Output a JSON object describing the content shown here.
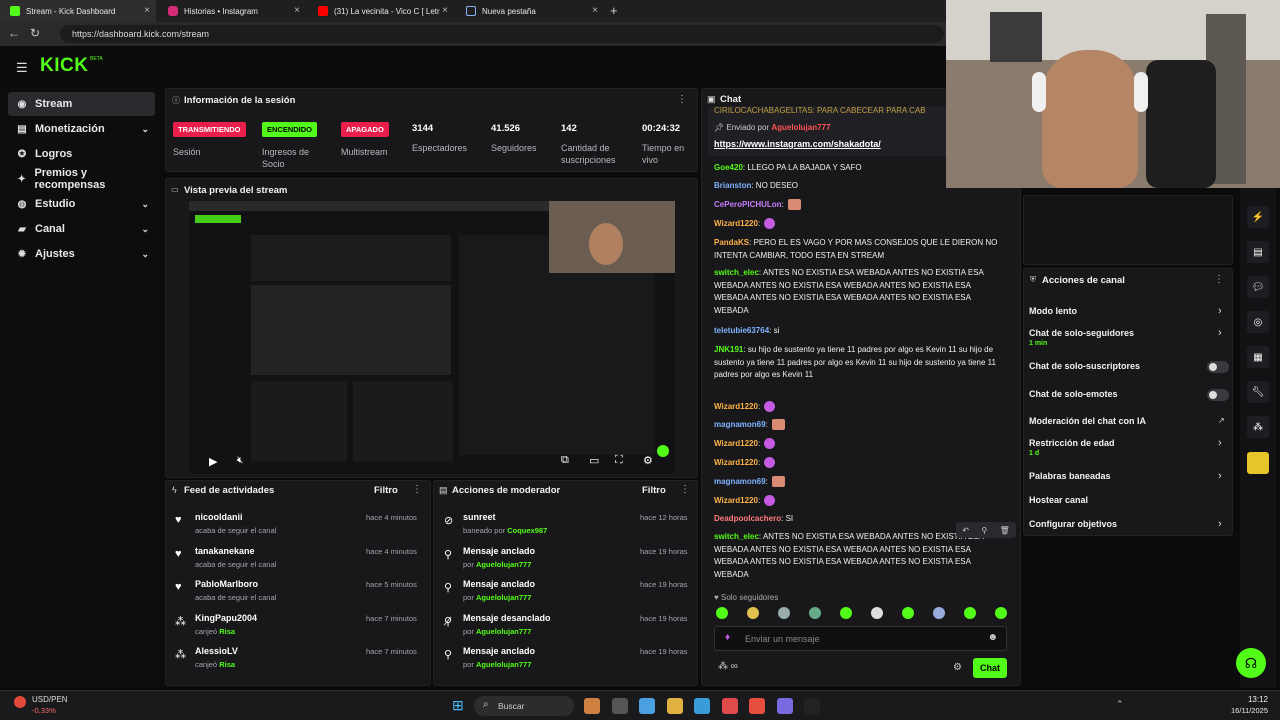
{
  "browser": {
    "tabs": [
      {
        "label": "Stream - Kick Dashboard",
        "color": "#53fc18"
      },
      {
        "label": "Historias • Instagram",
        "color": "#d62976"
      },
      {
        "label": "(31) La vecinita - Vico C [ Letra ] -",
        "color": "#ff0000"
      },
      {
        "label": "Nueva pestaña",
        "color": "#8ab4f8"
      }
    ],
    "new_tab": "+",
    "url": "https://dashboard.kick.com/stream"
  },
  "brand": {
    "logo": "KICK",
    "tag": "BETA"
  },
  "sidebar": {
    "items": [
      {
        "label": "Stream",
        "icon": "stream-icon",
        "glyph": "◉"
      },
      {
        "label": "Monetización",
        "icon": "money-icon",
        "glyph": "▤",
        "chev": "⌄"
      },
      {
        "label": "Logros",
        "icon": "trophy-icon",
        "glyph": "✪"
      },
      {
        "label": "Premios y recompensas",
        "icon": "gift-icon",
        "glyph": "✦"
      },
      {
        "label": "Estudio",
        "icon": "studio-icon",
        "glyph": "◍",
        "chev": "⌄"
      },
      {
        "label": "Canal",
        "icon": "channel-icon",
        "glyph": "▰",
        "chev": "⌄"
      },
      {
        "label": "Ajustes",
        "icon": "settings-icon",
        "glyph": "✹",
        "chev": "⌄"
      }
    ]
  },
  "session": {
    "title": "Información de la sesión",
    "stats": [
      {
        "badge": "TRANSMITIENDO",
        "badge_color": "#e91e4b",
        "label": "Sesión"
      },
      {
        "badge": "ENCENDIDO",
        "badge_color": "#53fc18",
        "label": "Ingresos de Socio"
      },
      {
        "badge": "APAGADO",
        "badge_color": "#e91e4b",
        "label": "Multistream"
      },
      {
        "value": "3144",
        "label": "Espectadores"
      },
      {
        "value": "41.526",
        "label": "Seguidores"
      },
      {
        "value": "142",
        "label": "Cantidad de suscripciones"
      },
      {
        "value": "00:24:32",
        "label": "Tiempo en vivo"
      }
    ]
  },
  "preview": {
    "title": "Vista previa del stream"
  },
  "activity": {
    "title": "Feed de actividades",
    "filter": "Filtro",
    "items": [
      {
        "name": "nicooldanii",
        "sub": "acaba de seguir el canal",
        "time": "hace 4 minutos",
        "icon": "heart-icon"
      },
      {
        "name": "tanakanekane",
        "sub": "acaba de seguir el canal",
        "time": "hace 4 minutos",
        "icon": "heart-icon"
      },
      {
        "name": "PabloMarlboro",
        "sub": "acaba de seguir el canal",
        "time": "hace 5 minutos",
        "icon": "heart-icon"
      },
      {
        "name": "KingPapu2004",
        "sub": "canjeó",
        "extra": "Risa",
        "time": "hace 7 minutos",
        "icon": "redeem-icon"
      },
      {
        "name": "AlessioLV",
        "sub": "canjeó",
        "extra": "Risa",
        "time": "hace 7 minutos",
        "icon": "redeem-icon"
      }
    ]
  },
  "moderation": {
    "title": "Acciones de moderador",
    "filter": "Filtro",
    "items": [
      {
        "name": "sunreet",
        "sub": "baneado por",
        "by": "Coquex987",
        "time": "hace 12 horas",
        "icon": "ban-icon"
      },
      {
        "name": "Mensaje anclado",
        "sub": "por",
        "by": "Aguelolujan777",
        "time": "hace 19 horas",
        "icon": "pin-icon"
      },
      {
        "name": "Mensaje anclado",
        "sub": "por",
        "by": "Aguelolujan777",
        "time": "hace 19 horas",
        "icon": "pin-icon"
      },
      {
        "name": "Mensaje desanclado",
        "sub": "por",
        "by": "Aguelolujan777",
        "time": "hace 19 horas",
        "icon": "unpin-icon"
      },
      {
        "name": "Mensaje anclado",
        "sub": "por",
        "by": "Aguelolujan777",
        "time": "hace 19 horas",
        "icon": "pin-icon"
      }
    ]
  },
  "chat": {
    "title": "Chat",
    "pinned": {
      "label": "Enviado por",
      "user": "Aguelolujan777",
      "link": "https://www.instagram.com/shakadota/",
      "top": "CIRILOCACHABAGELITAS: PARA CABECEAR  PARA CAB"
    },
    "messages": [
      {
        "user": "Goe420",
        "color": "#53fc18",
        "text": "LLEGO PA LA BAJADA Y SAFO"
      },
      {
        "user": "Brianston",
        "color": "#7fb3ff",
        "text": "NO DESEO"
      },
      {
        "user": "CePeroPICHULon",
        "color": "#c77dff",
        "text": ""
      },
      {
        "user": "Wizard1220",
        "color": "#ffb347",
        "text": ""
      },
      {
        "user": "PandaKS",
        "color": "#ffb347",
        "text": "PERO EL ES VAGO Y POR MAS CONSEJOS QUE LE DIERON NO INTENTA CAMBIAR, TODO ESTA EN STREAM"
      },
      {
        "user": "switch_elec",
        "color": "#53fc18",
        "text": "ANTES NO EXISTIA ESA WEBADA  ANTES NO EXISTIA ESA WEBADA  ANTES NO EXISTIA ESA WEBADA  ANTES NO EXISTIA ESA WEBADA  ANTES NO EXISTIA ESA WEBADA  ANTES NO EXISTIA ESA WEBADA"
      },
      {
        "user": "teletubie63764",
        "color": "#7fb3ff",
        "text": "si"
      },
      {
        "user": "JNK191",
        "color": "#53fc18",
        "text": "su hijo de sustento ya tiene 11 padres por algo es Kevin 11  su hijo de sustento ya tiene 11 padres por algo es Kevin 11  su hijo de sustento ya tiene 11 padres por algo es Kevin 11"
      },
      {
        "user": "Wizard1220",
        "color": "#ffb347",
        "text": ""
      },
      {
        "user": "magnamon69",
        "color": "#7fb3ff",
        "text": ""
      },
      {
        "user": "Wizard1220",
        "color": "#ffb347",
        "text": ""
      },
      {
        "user": "Wizard1220",
        "color": "#ffb347",
        "text": ""
      },
      {
        "user": "magnamon69",
        "color": "#7fb3ff",
        "text": ""
      },
      {
        "user": "Wizard1220",
        "color": "#ffb347",
        "text": ""
      },
      {
        "user": "Deadpoolcachero",
        "color": "#ff7b7b",
        "text": "SI"
      },
      {
        "user": "switch_elec",
        "color": "#53fc18",
        "text": "ANTES NO EXISTIA ESA WEBADA  ANTES NO EXISTIA ESA WEBADA  ANTES NO EXISTIA ESA WEBADA  ANTES NO EXISTIA ESA WEBADA  ANTES NO EXISTIA ESA WEBADA  ANTES NO EXISTIA ESA WEBADA"
      }
    ],
    "followers_only": "Solo seguidores",
    "placeholder": "Enviar un mensaje",
    "send": "Chat"
  },
  "channel_actions": {
    "title": "Acciones de canal",
    "items": [
      {
        "label": "Modo lento",
        "sub": "",
        "control": "chevron"
      },
      {
        "label": "Chat de solo-seguidores",
        "sub": "1 min",
        "control": "chevron"
      },
      {
        "label": "Chat de solo-suscriptores",
        "sub": "",
        "control": "toggle"
      },
      {
        "label": "Chat de solo-emotes",
        "sub": "",
        "control": "toggle"
      },
      {
        "label": "Moderación del chat con IA",
        "sub": "",
        "control": "external"
      },
      {
        "label": "Restricción de edad",
        "sub": "1 d",
        "control": "chevron"
      },
      {
        "label": "Palabras baneadas",
        "sub": "",
        "control": "chevron"
      },
      {
        "label": "Hostear canal",
        "sub": "",
        "control": "none"
      },
      {
        "label": "Configurar objetivos",
        "sub": "",
        "control": "chevron"
      }
    ]
  },
  "taskbar": {
    "ticker": "USD/PEN",
    "change": "-0.33%",
    "search": "Buscar",
    "time": "13:12",
    "date": "16/11/2025"
  }
}
